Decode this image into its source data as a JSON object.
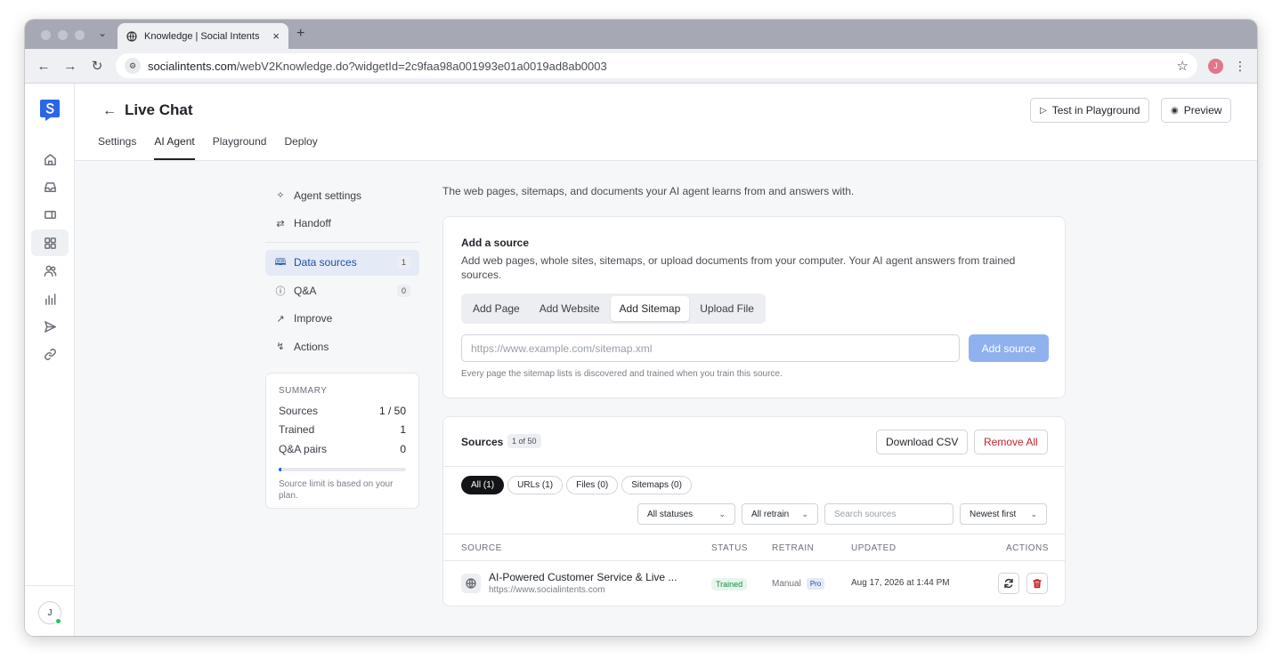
{
  "browser": {
    "tab_title": "Knowledge | Social Intents",
    "url_host": "socialintents.com",
    "url_path": "/webV2Knowledge.do?widgetId=2c9faa98a001993e01a0019ad8ab0003",
    "profile_initial": "J"
  },
  "header": {
    "title": "Live Chat",
    "test_button": "Test in Playground",
    "preview_button": "Preview",
    "tabs": [
      {
        "label": "Settings",
        "active": false
      },
      {
        "label": "AI Agent",
        "active": true
      },
      {
        "label": "Playground",
        "active": false
      },
      {
        "label": "Deploy",
        "active": false
      }
    ]
  },
  "rail": {
    "user_initial": "J",
    "items": [
      "home-icon",
      "inbox-icon",
      "ticket-icon",
      "apps-icon",
      "users-icon",
      "analytics-icon",
      "send-icon",
      "link-icon"
    ],
    "active_index": 3
  },
  "subnav": {
    "items": [
      {
        "label": "Agent settings",
        "icon": "sparkle-icon"
      },
      {
        "label": "Handoff",
        "icon": "swap-icon"
      }
    ],
    "items2": [
      {
        "label": "Data sources",
        "icon": "book-icon",
        "count": "1",
        "active": true
      },
      {
        "label": "Q&A",
        "icon": "question-icon",
        "count": "0"
      },
      {
        "label": "Improve",
        "icon": "trend-icon"
      },
      {
        "label": "Actions",
        "icon": "bolt-icon"
      }
    ]
  },
  "summary": {
    "heading": "SUMMARY",
    "rows": [
      {
        "label": "Sources",
        "value": "1 / 50"
      },
      {
        "label": "Trained",
        "value": "1"
      },
      {
        "label": "Q&A pairs",
        "value": "0"
      }
    ],
    "progress_fraction": 0.02,
    "note": "Source limit is based on your plan."
  },
  "intro": "The web pages, sitemaps, and documents your AI agent learns from and answers with.",
  "add_source": {
    "title": "Add a source",
    "description": "Add web pages, whole sites, sitemaps, or upload documents from your computer. Your AI agent answers from trained sources.",
    "modes": [
      {
        "label": "Add Page",
        "active": false
      },
      {
        "label": "Add Website",
        "active": false
      },
      {
        "label": "Add Sitemap",
        "active": true
      },
      {
        "label": "Upload File",
        "active": false
      }
    ],
    "input_placeholder": "https://www.example.com/sitemap.xml",
    "input_value": "",
    "button": "Add source",
    "hint": "Every page the sitemap lists is discovered and trained when you train this source."
  },
  "sources": {
    "title": "Sources",
    "count_badge": "1 of 50",
    "download_csv": "Download CSV",
    "remove_all": "Remove All",
    "chips": [
      {
        "label": "All (1)",
        "active": true
      },
      {
        "label": "URLs (1)",
        "active": false
      },
      {
        "label": "Files (0)",
        "active": false
      },
      {
        "label": "Sitemaps (0)",
        "active": false
      }
    ],
    "filter_status": "All statuses",
    "filter_retrain": "All retrain",
    "search_placeholder": "Search sources",
    "sort": "Newest first",
    "columns": {
      "source": "SOURCE",
      "status": "STATUS",
      "retrain": "RETRAIN",
      "updated": "UPDATED",
      "actions": "ACTIONS"
    },
    "rows": [
      {
        "name": "AI-Powered Customer Service & Live ...",
        "url": "https://www.socialintents.com",
        "status": "Trained",
        "retrain": "Manual",
        "retrain_badge": "Pro",
        "updated": "Aug 17, 2026 at 1:44 PM"
      }
    ]
  },
  "colors": {
    "accent": "#2563eb",
    "danger": "#c0262d",
    "success": "#1d8a45"
  }
}
